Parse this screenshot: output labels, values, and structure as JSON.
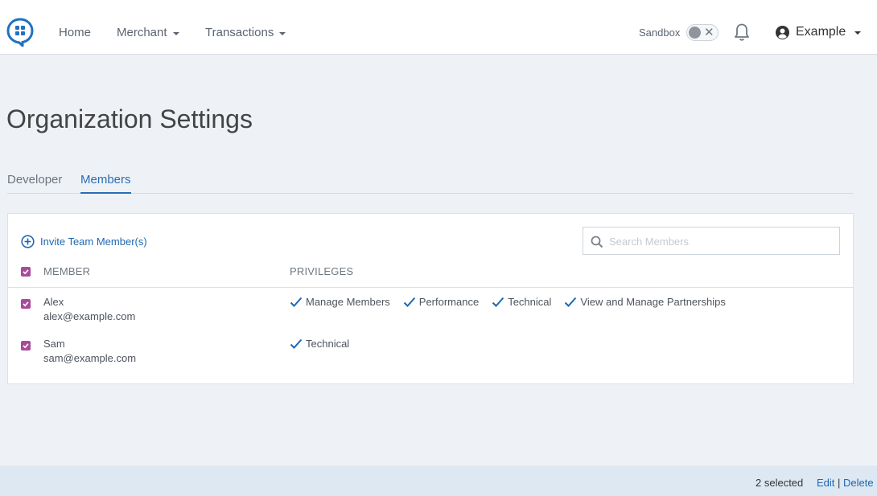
{
  "nav": {
    "home": "Home",
    "merchant": "Merchant",
    "transactions": "Transactions",
    "sandbox_label": "Sandbox",
    "user_name": "Example"
  },
  "page": {
    "title": "Organization Settings"
  },
  "tabs": [
    {
      "label": "Developer",
      "active": false
    },
    {
      "label": "Members",
      "active": true
    }
  ],
  "members_panel": {
    "invite_label": "Invite Team Member(s)",
    "search_placeholder": "Search Members",
    "col_member": "MEMBER",
    "col_privileges": "PRIVILEGES",
    "rows": [
      {
        "name": "Alex",
        "email": "alex@example.com",
        "selected": true,
        "privileges": [
          "Manage Members",
          "Performance",
          "Technical",
          "View and Manage Partnerships"
        ]
      },
      {
        "name": "Sam",
        "email": "sam@example.com",
        "selected": true,
        "privileges": [
          "Technical"
        ]
      }
    ]
  },
  "footer": {
    "selected_count": "2 selected",
    "edit_label": "Edit",
    "separator": "|",
    "delete_label": "Delete"
  },
  "colors": {
    "accent": "#2a6db5",
    "checkbox": "#a94a9c",
    "footer_bg": "#dde8f3"
  },
  "icons": {
    "logo": "speech-bubble-grid-logo",
    "bell": "bell-icon",
    "user": "user-circle-icon",
    "invite": "plus-circle-icon",
    "search": "search-icon",
    "check": "check-icon"
  }
}
